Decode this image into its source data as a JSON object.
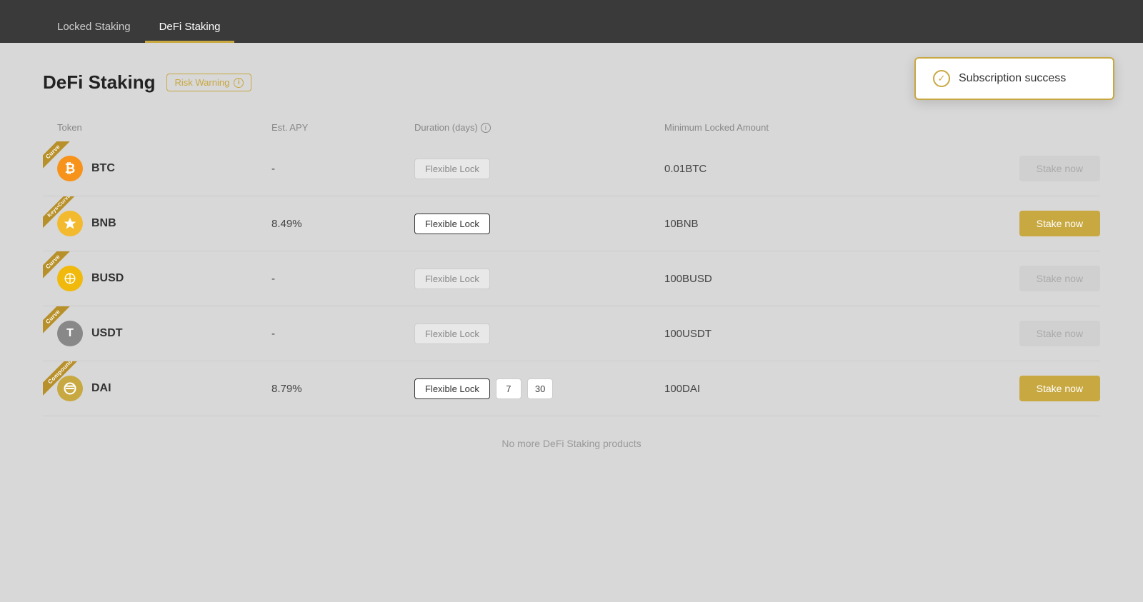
{
  "nav": {
    "tabs": [
      {
        "id": "locked-staking",
        "label": "Locked Staking",
        "active": false
      },
      {
        "id": "defi-staking",
        "label": "DeFi Staking",
        "active": true
      }
    ]
  },
  "page": {
    "title": "DeFi Staking",
    "risk_warning_label": "Risk Warning",
    "no_more_text": "No more DeFi Staking products"
  },
  "table": {
    "headers": {
      "token": "Token",
      "est_apy": "Est. APY",
      "duration": "Duration (days)",
      "min_locked": "Minimum Locked Amount",
      "action": ""
    },
    "rows": [
      {
        "id": "btc",
        "token_symbol": "BTC",
        "token_icon": "₿",
        "badge": "Curve",
        "apy": "-",
        "flexible_lock_active": false,
        "duration_numbers": [],
        "min_amount": "0.01BTC",
        "stake_btn_label": "Stake now",
        "stake_btn_active": false
      },
      {
        "id": "bnb",
        "token_symbol": "BNB",
        "token_icon": "◈",
        "badge": "Keys•Curve",
        "apy": "8.49%",
        "flexible_lock_active": true,
        "duration_numbers": [],
        "min_amount": "10BNB",
        "stake_btn_label": "Stake now",
        "stake_btn_active": true
      },
      {
        "id": "busd",
        "token_symbol": "BUSD",
        "token_icon": "$",
        "badge": "Curve",
        "apy": "-",
        "flexible_lock_active": false,
        "duration_numbers": [],
        "min_amount": "100BUSD",
        "stake_btn_label": "Stake now",
        "stake_btn_active": false
      },
      {
        "id": "usdt",
        "token_symbol": "USDT",
        "token_icon": "T",
        "badge": "Curve",
        "apy": "-",
        "flexible_lock_active": false,
        "duration_numbers": [],
        "min_amount": "100USDT",
        "stake_btn_label": "Stake now",
        "stake_btn_active": false
      },
      {
        "id": "dai",
        "token_symbol": "DAI",
        "token_icon": "⊜",
        "badge": "Compound",
        "apy": "8.79%",
        "flexible_lock_active": true,
        "duration_numbers": [
          7,
          30
        ],
        "min_amount": "100DAI",
        "stake_btn_label": "Stake now",
        "stake_btn_active": true
      }
    ]
  },
  "notification": {
    "text": "Subscription success"
  }
}
